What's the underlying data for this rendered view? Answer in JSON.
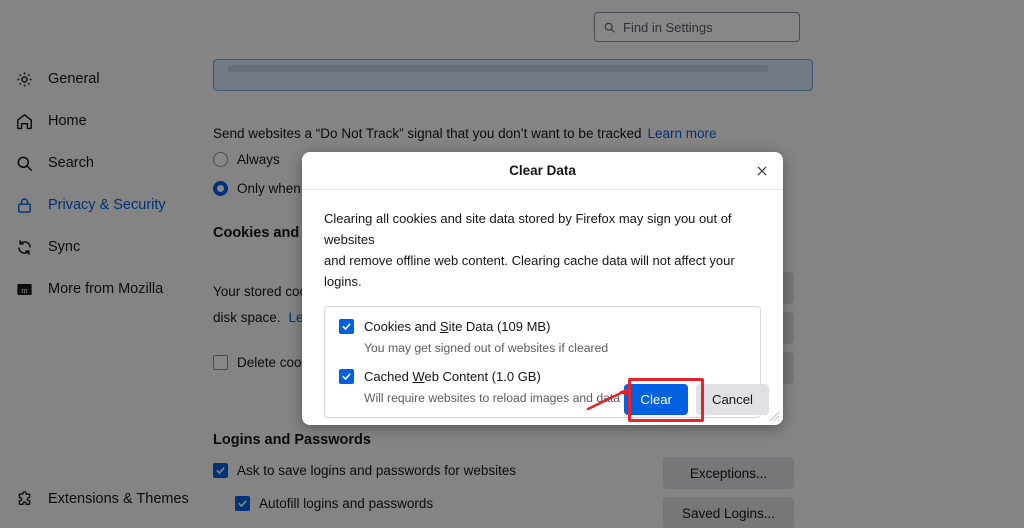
{
  "sidebar": {
    "items": [
      {
        "label": "General",
        "icon": "gear-icon",
        "active": false
      },
      {
        "label": "Home",
        "icon": "home-icon",
        "active": false
      },
      {
        "label": "Search",
        "icon": "search-icon",
        "active": false
      },
      {
        "label": "Privacy & Security",
        "icon": "lock-icon",
        "active": true
      },
      {
        "label": "Sync",
        "icon": "sync-icon",
        "active": false
      },
      {
        "label": "More from Mozilla",
        "icon": "mozilla-icon",
        "active": false
      }
    ],
    "bottom_item": {
      "label": "Extensions & Themes",
      "icon": "puzzle-icon"
    }
  },
  "search": {
    "placeholder": "Find in Settings",
    "icon": "search-icon"
  },
  "settings": {
    "dnt_text": "Send websites a “Do Not Track” signal that you don’t want to be tracked",
    "dnt_learn_more": "Learn more",
    "radios": [
      {
        "label": "Always",
        "checked": false
      },
      {
        "label": "Only when ",
        "checked": true
      }
    ],
    "cookies_heading": "Cookies and",
    "cookies_desc_line1": "Your stored coo",
    "cookies_desc_line2": "disk space.",
    "cookies_desc_link": "Le",
    "delete_cookies_label": "Delete cook",
    "right_buttons": [
      "",
      "",
      ""
    ],
    "logins_heading": "Logins and Passwords",
    "ask_save_label": "Ask to save logins and passwords for websites",
    "autofill_label": "Autofill logins and passwords",
    "exceptions_label": "Exceptions...",
    "saved_logins_label": "Saved Logins..."
  },
  "dialog": {
    "title": "Clear Data",
    "close_icon": "close-icon",
    "body_line1": "Clearing all cookies and site data stored by Firefox may sign you out of websites",
    "body_line2": "and remove offline web content. Clearing cache data will not affect your logins.",
    "options": [
      {
        "label_pre": "Cookies and ",
        "label_accesskey": "S",
        "label_post": "ite Data (109 MB)",
        "sublabel": "You may get signed out of websites if cleared",
        "checked": true
      },
      {
        "label_pre": "Cached ",
        "label_accesskey": "W",
        "label_post": "eb Content (1.0 GB)",
        "sublabel": "Will require websites to reload images and data",
        "checked": true
      }
    ],
    "primary_button": "Clear",
    "secondary_button": "Cancel",
    "resize_grip_icon": "resize-grip-icon"
  },
  "annotation": {
    "highlight_target": "Clear",
    "color": "#e8222a",
    "arrow_icon": "arrow-pointer-icon"
  },
  "colors": {
    "accent": "#0060df",
    "annotation_red": "#e8222a",
    "dialog_bg": "#ffffff",
    "page_bg": "#f9f9fb",
    "button_bg": "#e0e0e6"
  }
}
